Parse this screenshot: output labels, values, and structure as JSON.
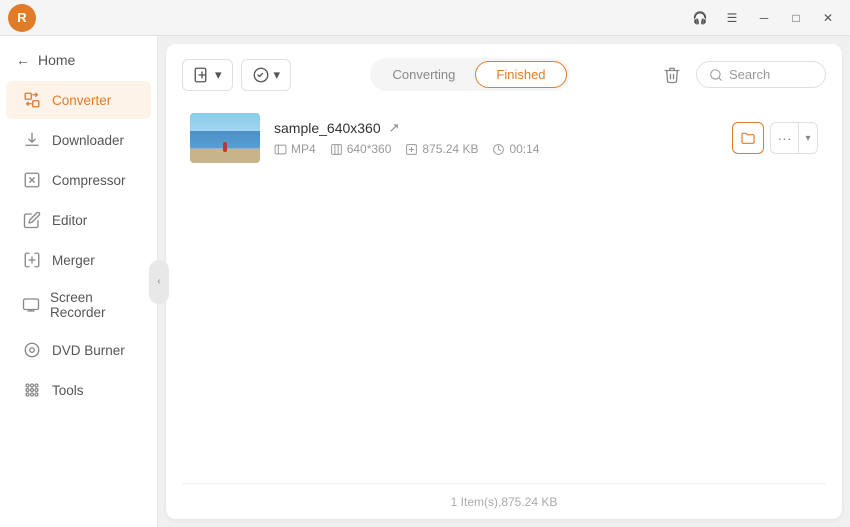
{
  "titlebar": {
    "avatar_label": "R",
    "btn_headphones": "🎧",
    "btn_menu": "☰",
    "btn_minimize": "─",
    "btn_maximize": "□",
    "btn_close": "✕"
  },
  "sidebar": {
    "home_label": "Home",
    "items": [
      {
        "id": "converter",
        "label": "Converter",
        "icon": "converter",
        "active": true
      },
      {
        "id": "downloader",
        "label": "Downloader",
        "icon": "downloader",
        "active": false
      },
      {
        "id": "compressor",
        "label": "Compressor",
        "icon": "compressor",
        "active": false
      },
      {
        "id": "editor",
        "label": "Editor",
        "icon": "editor",
        "active": false
      },
      {
        "id": "merger",
        "label": "Merger",
        "icon": "merger",
        "active": false
      },
      {
        "id": "screen-recorder",
        "label": "Screen Recorder",
        "icon": "screen-recorder",
        "active": false
      },
      {
        "id": "dvd-burner",
        "label": "DVD Burner",
        "icon": "dvd-burner",
        "active": false
      },
      {
        "id": "tools",
        "label": "Tools",
        "icon": "tools",
        "active": false
      }
    ]
  },
  "toolbar": {
    "add_file_label": "",
    "add_btn_arrow": "▾",
    "convert_btn_arrow": "▾",
    "delete_icon": "🗑",
    "search_placeholder": "Search"
  },
  "tabs": {
    "converting_label": "Converting",
    "finished_label": "Finished",
    "active": "finished"
  },
  "file": {
    "name": "sample_640x360",
    "format": "MP4",
    "resolution": "640*360",
    "size": "875.24 KB",
    "duration": "00:14"
  },
  "footer": {
    "summary": "1 Item(s),875.24 KB"
  }
}
